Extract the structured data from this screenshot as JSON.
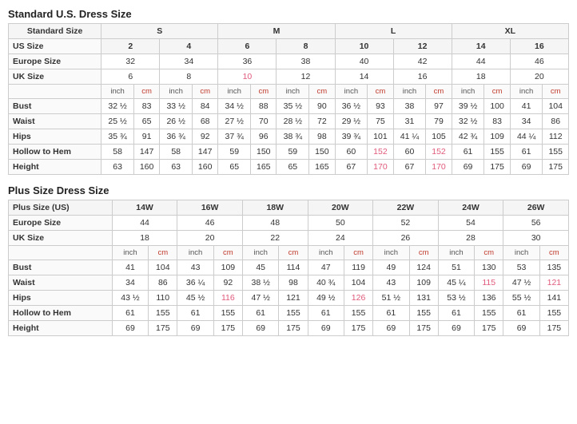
{
  "standard_title": "Standard U.S. Dress Size",
  "plus_title": "Plus Size Dress Size",
  "standard_table": {
    "size_groups": [
      {
        "label": "Standard Size",
        "cols": [
          "S",
          "",
          "M",
          "",
          "L",
          "",
          "XL",
          ""
        ]
      },
      {
        "label": "US Size",
        "cols": [
          "2",
          "4",
          "6",
          "8",
          "10",
          "12",
          "14",
          "16"
        ],
        "bold": true
      },
      {
        "label": "Europe Size",
        "cols": [
          "32",
          "34",
          "36",
          "38",
          "40",
          "42",
          "44",
          "46"
        ]
      },
      {
        "label": "UK Size",
        "cols": [
          "6",
          "8",
          "10",
          "12",
          "14",
          "16",
          "18",
          "20"
        ],
        "pink_indices": [
          2
        ]
      }
    ],
    "unit_cols": [
      "inch",
      "cm",
      "inch",
      "cm",
      "inch",
      "cm",
      "inch",
      "cm",
      "inch",
      "cm",
      "inch",
      "cm",
      "inch",
      "cm",
      "inch",
      "cm"
    ],
    "rows": [
      {
        "label": "Bust",
        "vals": [
          "32 ½",
          "83",
          "33 ½",
          "84",
          "34 ½",
          "88",
          "35 ½",
          "90",
          "36 ½",
          "93",
          "38",
          "97",
          "39 ½",
          "100",
          "41",
          "104"
        ]
      },
      {
        "label": "Waist",
        "vals": [
          "25 ½",
          "65",
          "26 ½",
          "68",
          "27 ½",
          "70",
          "28 ½",
          "72",
          "29 ½",
          "75",
          "31",
          "79",
          "32 ½",
          "83",
          "34",
          "86"
        ]
      },
      {
        "label": "Hips",
        "vals": [
          "35 ¾",
          "91",
          "36 ¾",
          "92",
          "37 ¾",
          "96",
          "38 ¾",
          "98",
          "39 ¾",
          "101",
          "41 ¼",
          "105",
          "42 ¾",
          "109",
          "44 ¼",
          "112"
        ]
      },
      {
        "label": "Hollow to Hem",
        "vals": [
          "58",
          "147",
          "58",
          "147",
          "59",
          "150",
          "59",
          "150",
          "60",
          "152",
          "60",
          "152",
          "61",
          "155",
          "61",
          "155"
        ],
        "pink_indices": [
          9,
          11
        ]
      },
      {
        "label": "Height",
        "vals": [
          "63",
          "160",
          "63",
          "160",
          "65",
          "165",
          "65",
          "165",
          "67",
          "170",
          "67",
          "170",
          "69",
          "175",
          "69",
          "175"
        ],
        "pink_indices": [
          9,
          11
        ]
      }
    ]
  },
  "plus_table": {
    "size_groups": [
      {
        "label": "Plus Size (US)",
        "cols": [
          "14W",
          "16W",
          "18W",
          "20W",
          "22W",
          "24W",
          "26W"
        ]
      },
      {
        "label": "Europe Size",
        "cols": [
          "44",
          "46",
          "48",
          "50",
          "52",
          "54",
          "56"
        ]
      },
      {
        "label": "UK Size",
        "cols": [
          "18",
          "20",
          "22",
          "24",
          "26",
          "28",
          "30"
        ]
      }
    ],
    "unit_cols": [
      "inch",
      "cm",
      "inch",
      "cm",
      "inch",
      "cm",
      "inch",
      "cm",
      "inch",
      "cm",
      "inch",
      "cm",
      "inch",
      "cm"
    ],
    "rows": [
      {
        "label": "Bust",
        "vals": [
          "41",
          "104",
          "43",
          "109",
          "45",
          "114",
          "47",
          "119",
          "49",
          "124",
          "51",
          "130",
          "53",
          "135"
        ]
      },
      {
        "label": "Waist",
        "vals": [
          "34",
          "86",
          "36 ¼",
          "92",
          "38 ½",
          "98",
          "40 ¾",
          "104",
          "43",
          "109",
          "45 ¼",
          "115",
          "47 ½",
          "121"
        ],
        "pink_indices": [
          11,
          13
        ]
      },
      {
        "label": "Hips",
        "vals": [
          "43 ½",
          "110",
          "45 ½",
          "116",
          "47 ½",
          "121",
          "49 ½",
          "126",
          "51 ½",
          "131",
          "53 ½",
          "136",
          "55 ½",
          "141"
        ],
        "pink_indices": [
          3,
          7
        ]
      },
      {
        "label": "Hollow to Hem",
        "vals": [
          "61",
          "155",
          "61",
          "155",
          "61",
          "155",
          "61",
          "155",
          "61",
          "155",
          "61",
          "155",
          "61",
          "155"
        ]
      },
      {
        "label": "Height",
        "vals": [
          "69",
          "175",
          "69",
          "175",
          "69",
          "175",
          "69",
          "175",
          "69",
          "175",
          "69",
          "175",
          "69",
          "175"
        ]
      }
    ]
  }
}
